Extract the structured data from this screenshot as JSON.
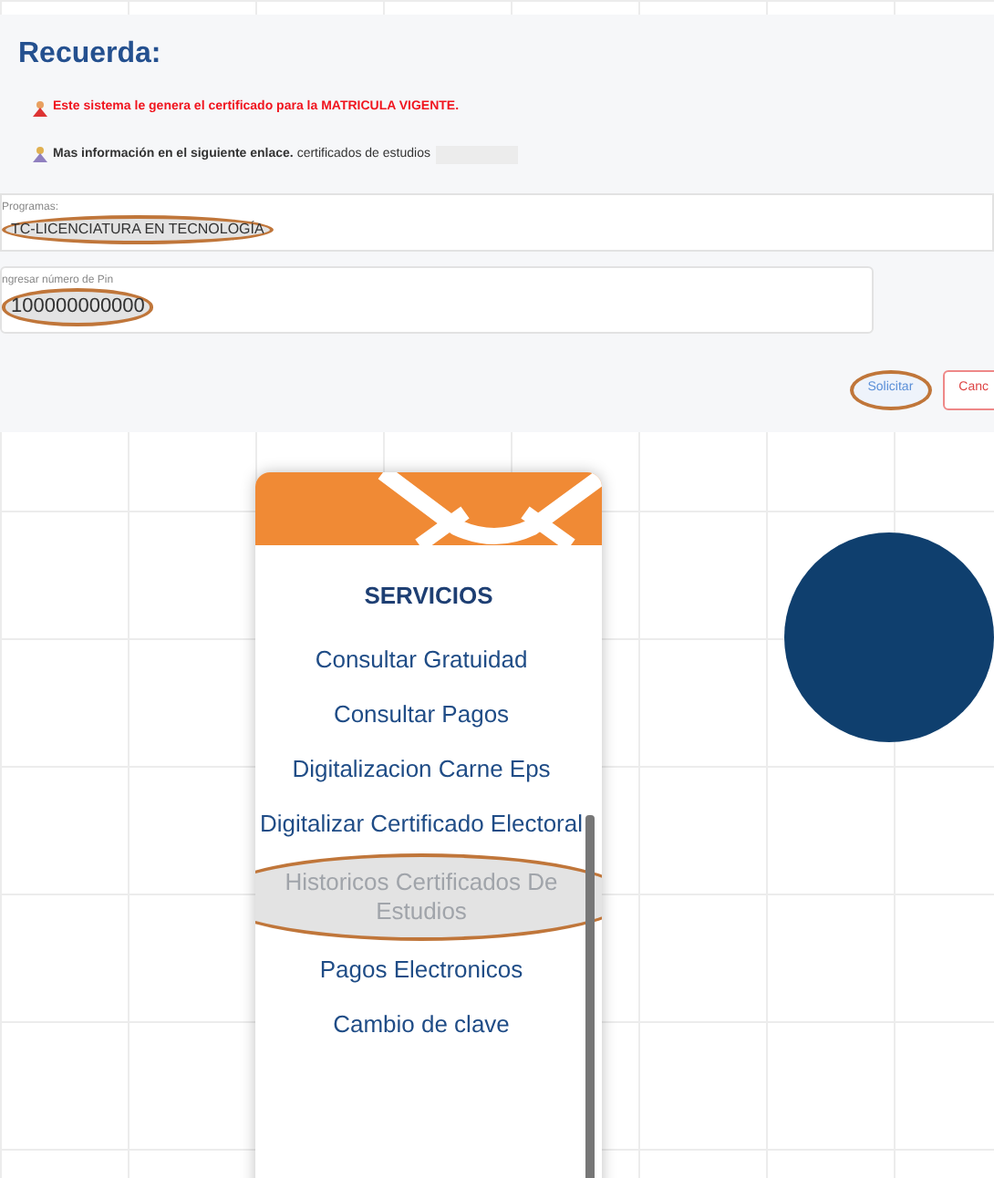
{
  "notice": {
    "title": "Recuerda:",
    "warning": "Este sistema le genera el certificado para la MATRICULA VIGENTE.",
    "info": "**Mas información en el siguiente enlace.** certificados de estudios"
  },
  "form": {
    "fields": [
      {
        "label": "Programas:",
        "value": "TC-LICENCIATURA EN TECNOLOGÍA",
        "highlighted": true
      },
      {
        "label": "ngresar número de Pin",
        "value": "100000000000",
        "highlighted": true
      }
    ],
    "buttons": [
      {
        "kind": "primary",
        "label": "Solicitar",
        "highlighted": true
      },
      {
        "kind": "danger",
        "label": "Canc",
        "highlighted": false
      }
    ]
  },
  "services": {
    "title": "SERVICIOS",
    "items": [
      {
        "label": "Consultar Gratuidad",
        "highlighted": false
      },
      {
        "label": "Consultar Pagos",
        "highlighted": false
      },
      {
        "label": "Digitalizacion Carne Eps",
        "highlighted": false
      },
      {
        "label": "Digitalizar Certificado Electoral",
        "highlighted": false
      },
      {
        "label": "Historicos Certificados De Estudios",
        "highlighted": true
      },
      {
        "label": "Pagos Electronicos",
        "highlighted": false
      },
      {
        "label": "Cambio de clave",
        "highlighted": false
      }
    ]
  }
}
